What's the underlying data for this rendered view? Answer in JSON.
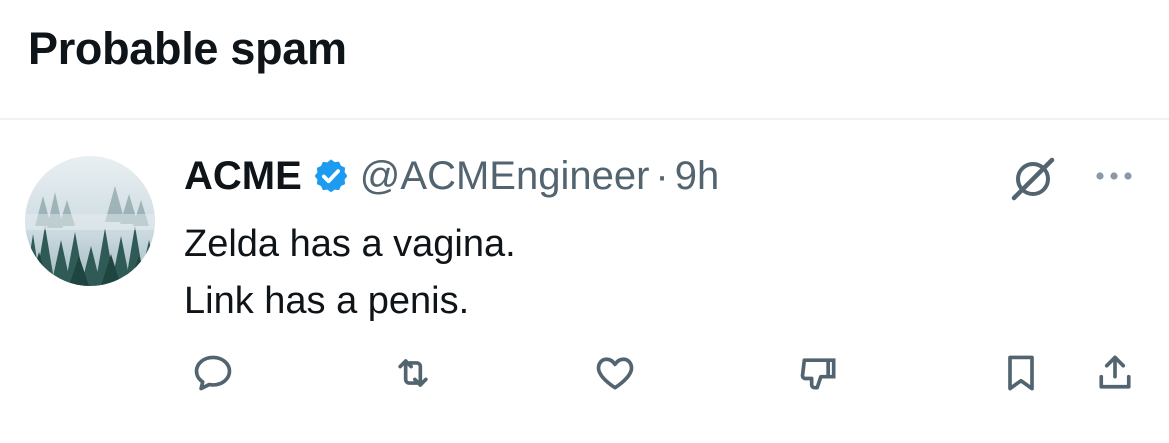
{
  "section": {
    "title": "Probable spam"
  },
  "tweet": {
    "author_name": "ACME",
    "verified": true,
    "handle": "@ACMEngineer",
    "separator": "·",
    "time": "9h",
    "lines": [
      "Zelda has a vagina.",
      "Link has a penis."
    ]
  },
  "icons": {
    "verified": "verified-badge-icon",
    "grok": "grok-icon",
    "more": "more-icon",
    "reply": "reply-icon",
    "retweet": "retweet-icon",
    "like": "like-icon",
    "downvote": "downvote-icon",
    "bookmark": "bookmark-icon",
    "share": "share-icon"
  },
  "colors": {
    "text_primary": "#0f1419",
    "text_secondary": "#536471",
    "verified_blue": "#1d9bf0",
    "divider": "#eff3f4"
  }
}
